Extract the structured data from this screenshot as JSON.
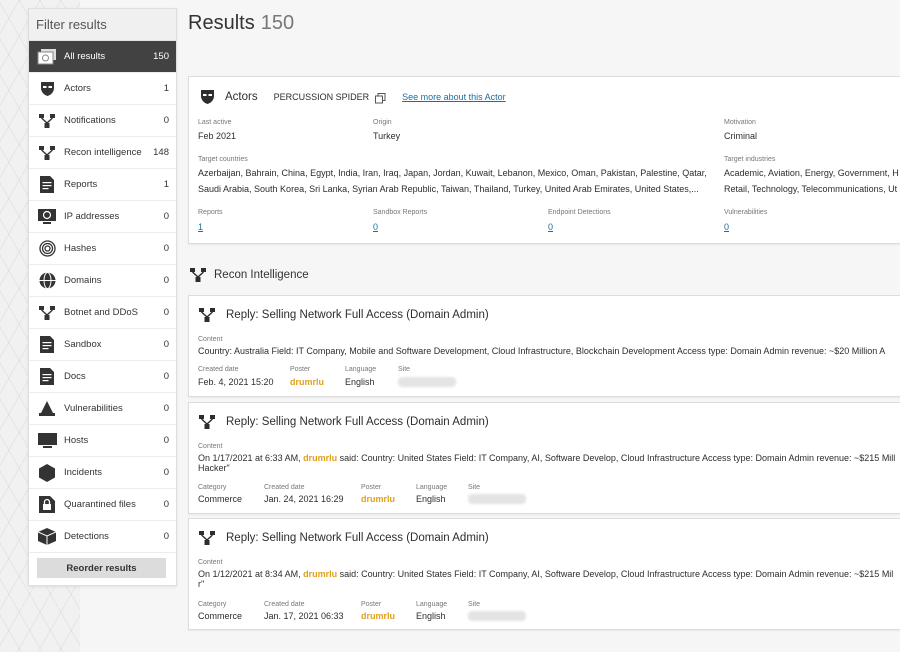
{
  "sidebar": {
    "title": "Filter results",
    "items": [
      {
        "label": "All results",
        "count": "150",
        "icon": "all-results-icon"
      },
      {
        "label": "Actors",
        "count": "1",
        "icon": "actor-mask-icon"
      },
      {
        "label": "Notifications",
        "count": "0",
        "icon": "network-icon"
      },
      {
        "label": "Recon intelligence",
        "count": "148",
        "icon": "network-icon"
      },
      {
        "label": "Reports",
        "count": "1",
        "icon": "document-icon"
      },
      {
        "label": "IP addresses",
        "count": "0",
        "icon": "ip-monitor-icon"
      },
      {
        "label": "Hashes",
        "count": "0",
        "icon": "fingerprint-icon"
      },
      {
        "label": "Domains",
        "count": "0",
        "icon": "globe-icon"
      },
      {
        "label": "Botnet and DDoS",
        "count": "0",
        "icon": "network-icon"
      },
      {
        "label": "Sandbox",
        "count": "0",
        "icon": "document-icon"
      },
      {
        "label": "Docs",
        "count": "0",
        "icon": "document-icon"
      },
      {
        "label": "Vulnerabilities",
        "count": "0",
        "icon": "cone-icon"
      },
      {
        "label": "Hosts",
        "count": "0",
        "icon": "monitor-icon"
      },
      {
        "label": "Incidents",
        "count": "0",
        "icon": "hexagon-icon"
      },
      {
        "label": "Quarantined files",
        "count": "0",
        "icon": "lock-file-icon"
      },
      {
        "label": "Detections",
        "count": "0",
        "icon": "cube-icon"
      }
    ],
    "reorder_label": "Reorder results"
  },
  "header": {
    "title": "Results",
    "count": "150"
  },
  "actor": {
    "section": "Actors",
    "name": "PERCUSSION SPIDER",
    "see_more": "See more about this Actor",
    "last_active_label": "Last active",
    "last_active": "Feb 2021",
    "origin_label": "Origin",
    "origin": "Turkey",
    "motivation_label": "Motivation",
    "motivation": "Criminal",
    "countries_label": "Target countries",
    "countries_line1": "Azerbaijan, Bahrain, China, Egypt, India, Iran, Iraq, Japan, Jordan, Kuwait, Lebanon, Mexico, Oman, Pakistan, Palestine, Qatar,",
    "countries_line2": "Saudi Arabia, South Korea, Sri Lanka, Syrian Arab Republic, Taiwan, Thailand, Turkey, United Arab Emirates, United States,...",
    "industries_label": "Target industries",
    "industries_line1": "Academic, Aviation, Energy, Government, H",
    "industries_line2": "Retail, Technology, Telecommunications, Ut",
    "reports_label": "Reports",
    "reports": "1",
    "sandbox_label": "Sandbox Reports",
    "sandbox": "0",
    "endpoint_label": "Endpoint Detections",
    "endpoint": "0",
    "vulns_label": "Vulnerabilities",
    "vulns": "0"
  },
  "recon": {
    "section": "Recon Intelligence",
    "posts": [
      {
        "title": "Reply: Selling Network Full Access (Domain Admin)",
        "content_label": "Content",
        "content": "Country: Australia Field: IT Company, Mobile and Software Development, Cloud Infrastructure, Blockchain Development Access type: Domain Admin revenue: ~$20 Million A",
        "created_label": "Created date",
        "created": "Feb. 4, 2021 15:20",
        "poster_label": "Poster",
        "poster": "drumrlu",
        "language_label": "Language",
        "language": "English",
        "site_label": "Site"
      },
      {
        "title": "Reply: Selling Network Full Access (Domain Admin)",
        "content_label": "Content",
        "content_prefix": "On 1/17/2021 at 6:33 AM,",
        "content_poster": "drumrlu",
        "content_rest": "said: Country: United States Field: IT Company, AI, Software Develop, Cloud Infrastructure Access type: Domain Admin revenue: ~$215 Mill",
        "content_line2": "Hacker\"",
        "category_label": "Category",
        "category": "Commerce",
        "created_label": "Created date",
        "created": "Jan. 24, 2021 16:29",
        "poster_label": "Poster",
        "poster": "drumrlu",
        "language_label": "Language",
        "language": "English",
        "site_label": "Site"
      },
      {
        "title": "Reply: Selling Network Full Access (Domain Admin)",
        "content_label": "Content",
        "content_prefix": "On 1/12/2021 at 8:34 AM,",
        "content_poster": "drumrlu",
        "content_rest": "said: Country: United States Field: IT Company, AI, Software Develop, Cloud Infrastructure Access type: Domain Admin revenue: ~$215 Mil",
        "content_line2": "r\"",
        "category_label": "Category",
        "category": "Commerce",
        "created_label": "Created date",
        "created": "Jan. 17, 2021 06:33",
        "poster_label": "Poster",
        "poster": "drumrlu",
        "language_label": "Language",
        "language": "English",
        "site_label": "Site"
      }
    ]
  },
  "colors": {
    "accent_link": "#1a6fa0",
    "poster": "#e0a01e",
    "active_bg": "#424242"
  }
}
